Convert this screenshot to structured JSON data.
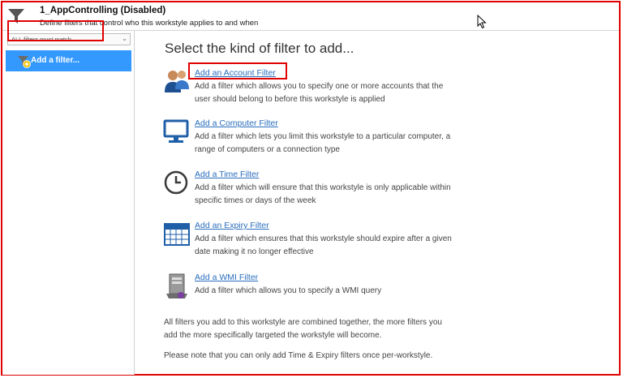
{
  "header": {
    "title": "1_AppControlling (Disabled)",
    "subtitle": "Define filters that control who this workstyle applies to and when"
  },
  "sidebar": {
    "match_select": "ALL filters must match",
    "add_item_label": "Add a filter..."
  },
  "main": {
    "heading": "Select the kind of filter to add...",
    "filters": [
      {
        "link": "Add an Account Filter",
        "desc": "Add a filter which allows you to specify one or more accounts that the user should belong to before this workstyle is applied",
        "icon": "users-icon"
      },
      {
        "link": "Add a Computer Filter",
        "desc": "Add a filter which lets you limit this workstyle to a particular computer, a range of computers or a connection type",
        "icon": "monitor-icon"
      },
      {
        "link": "Add a Time Filter",
        "desc": "Add a filter which will ensure that this workstyle is only applicable within specific times or days of the week",
        "icon": "clock-icon"
      },
      {
        "link": "Add an Expiry Filter",
        "desc": "Add a filter which ensures that this workstyle should expire after a given date making it no longer effective",
        "icon": "calendar-icon"
      },
      {
        "link": "Add a WMI Filter",
        "desc": "Add a filter which allows you to specify a WMI query",
        "icon": "wmi-computer-icon"
      }
    ],
    "note1": "All filters you add to this workstyle are combined together, the more filters you add the more specifically targeted the workstyle will become.",
    "note2": "Please note that you can only add Time & Expiry filters once per-workstyle."
  },
  "colors": {
    "accent": "#3399ff",
    "highlight": "#e00000",
    "link": "#2a6ebd"
  }
}
